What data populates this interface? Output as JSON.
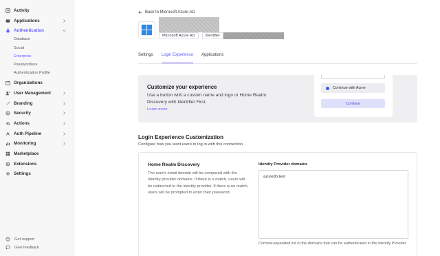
{
  "sidebar": {
    "items": [
      {
        "label": "Activity",
        "icon": "activity-icon",
        "expandable": false
      },
      {
        "label": "Applications",
        "icon": "applications-icon",
        "expandable": true
      },
      {
        "label": "Authentication",
        "icon": "authentication-icon",
        "expandable": true,
        "active": true
      },
      {
        "label": "Organizations",
        "icon": "organizations-icon",
        "expandable": false
      },
      {
        "label": "User Management",
        "icon": "user-management-icon",
        "expandable": true
      },
      {
        "label": "Branding",
        "icon": "branding-icon",
        "expandable": true
      },
      {
        "label": "Security",
        "icon": "security-icon",
        "expandable": true
      },
      {
        "label": "Actions",
        "icon": "actions-icon",
        "expandable": true
      },
      {
        "label": "Auth Pipeline",
        "icon": "auth-pipeline-icon",
        "expandable": true
      },
      {
        "label": "Monitoring",
        "icon": "monitoring-icon",
        "expandable": true
      },
      {
        "label": "Marketplace",
        "icon": "marketplace-icon",
        "expandable": false
      },
      {
        "label": "Extensions",
        "icon": "extensions-icon",
        "expandable": false
      },
      {
        "label": "Settings",
        "icon": "settings-icon",
        "expandable": false
      }
    ],
    "auth_subitems": [
      "Database",
      "Social",
      "Enterprise",
      "Passwordless",
      "Authentication Profile"
    ],
    "active_subitem": "Enterprise",
    "footer": [
      {
        "label": "Get support",
        "icon": "help-icon"
      },
      {
        "label": "Give feedback",
        "icon": "feedback-icon"
      }
    ]
  },
  "header": {
    "back_label": "Back to Microsoft Azure AD",
    "provider_badge": "Microsoft Azure AD",
    "identifier_label": "Identifier"
  },
  "tabs": [
    {
      "label": "Settings",
      "active": false
    },
    {
      "label": "Login Experience",
      "active": true
    },
    {
      "label": "Applications",
      "active": false
    }
  ],
  "banner": {
    "title": "Customize your experience",
    "text": "Use a button with a custom name and logo or Home Realm Discovery with Identifier First.",
    "link": "Learn more",
    "preview_button": "Continue with Acme",
    "preview_continue": "Continue"
  },
  "section": {
    "title": "Login Experience Customization",
    "description": "Configure how you want users to log in with this connection."
  },
  "hrd": {
    "title": "Home Realm Discovery",
    "description": "The user's email domain will be compared with the Identity provider domains. If there is a match, users will be redirected to the identity provider. If there is no match, users will be prompted to enter their password.",
    "field_label": "Identity Provider domains",
    "field_value": "azuredb.test",
    "field_help": "Comma-separated list of the domains that can be authenticated in the Identity Provider."
  },
  "colors": {
    "accent": "#635dff",
    "sidebar_bg": "#f7f7f8",
    "banner_bg": "#efeff2",
    "azure_blue": "#2f8ae6"
  }
}
